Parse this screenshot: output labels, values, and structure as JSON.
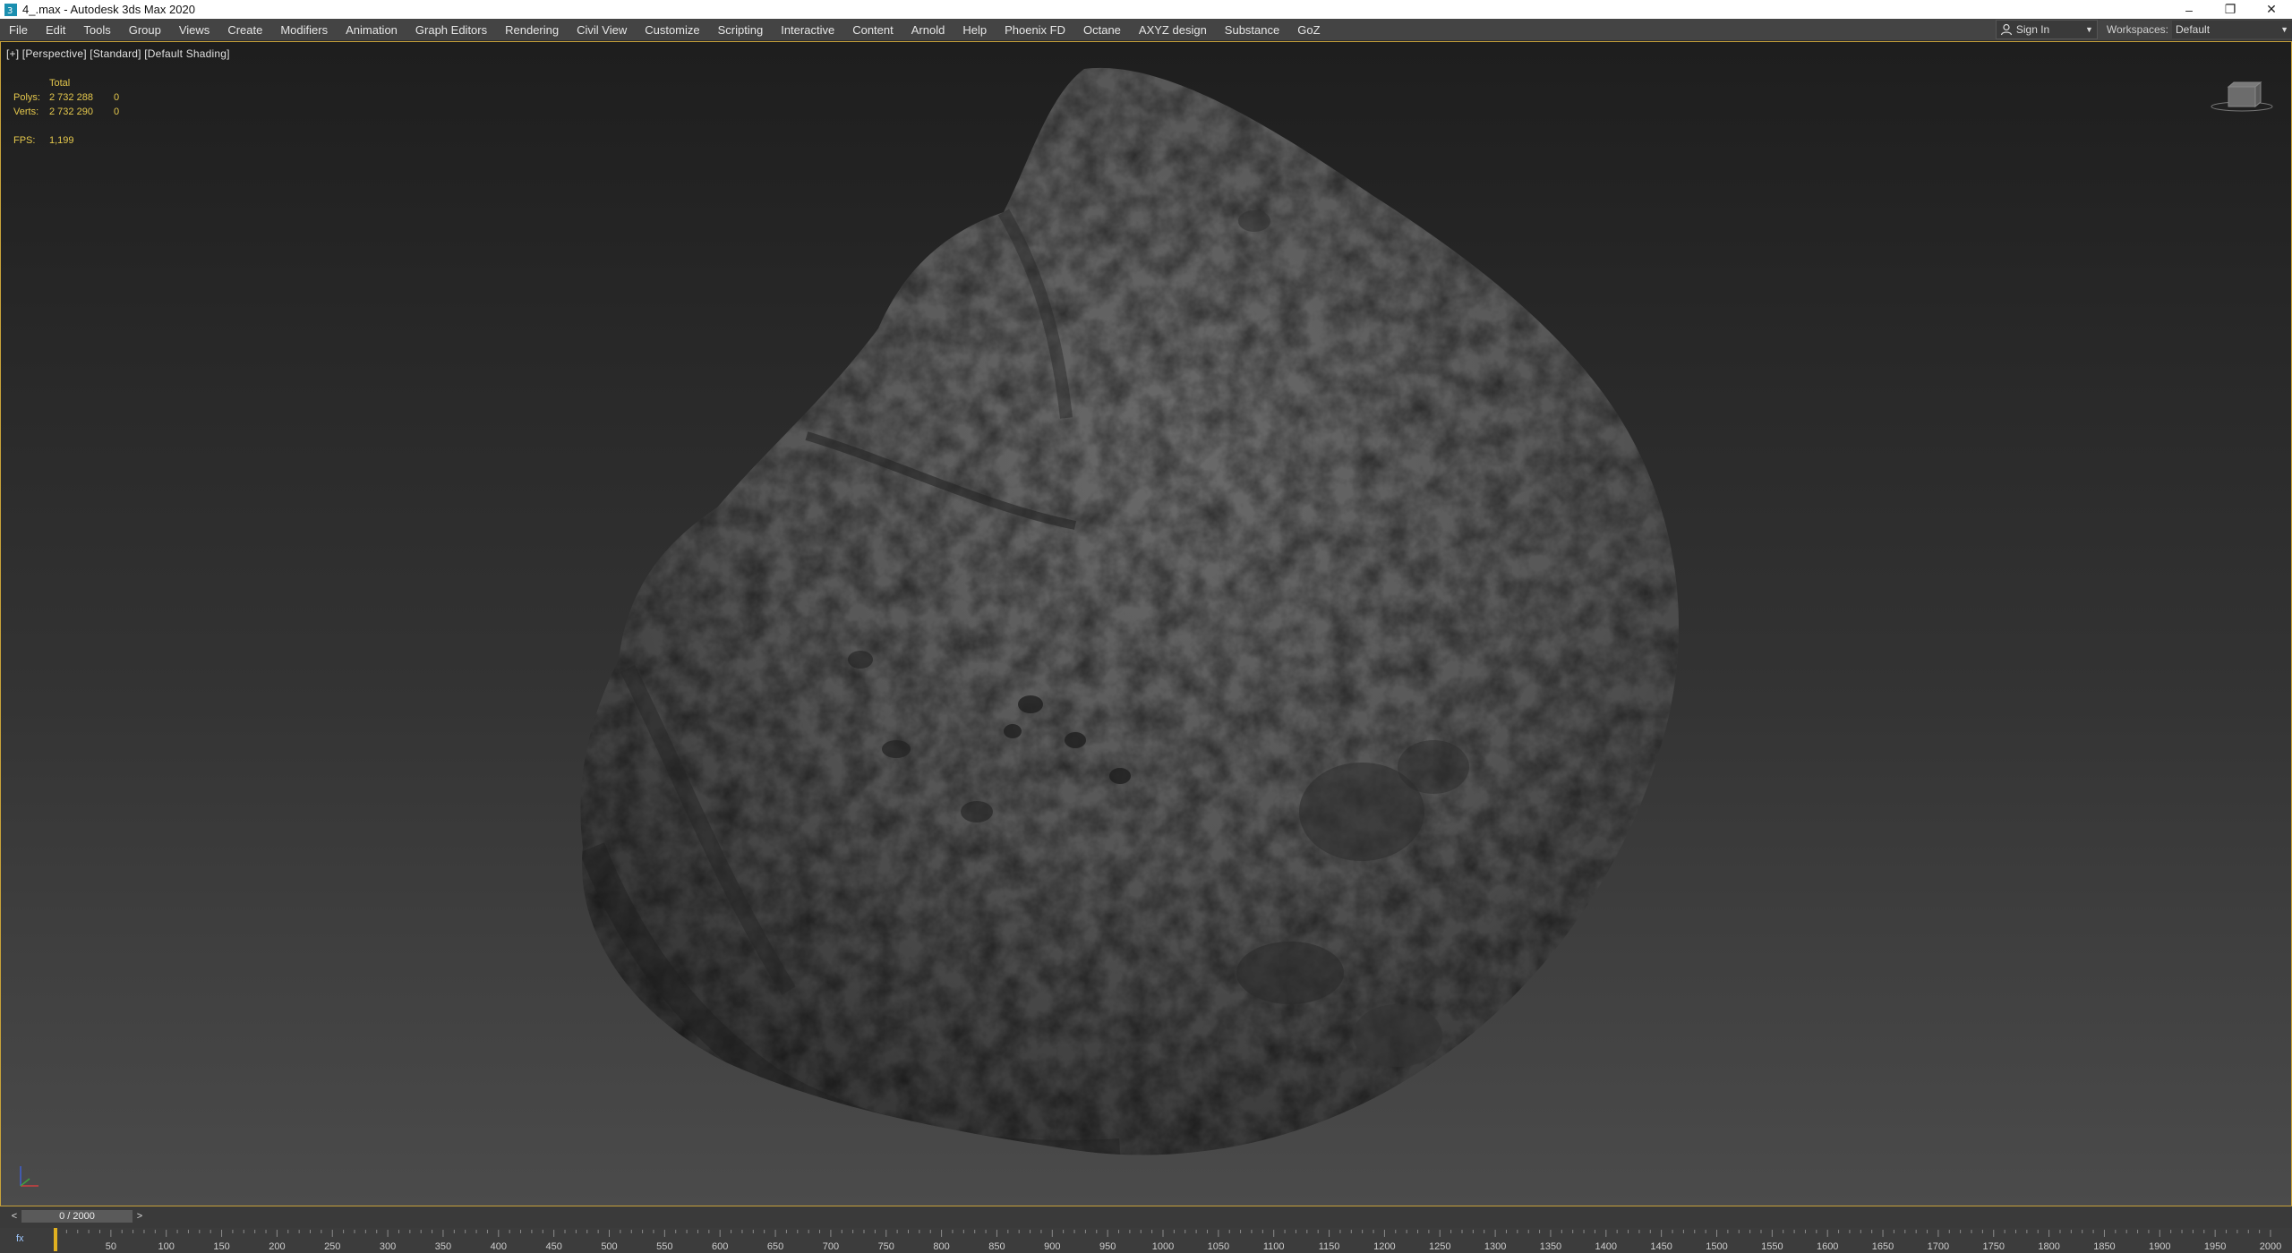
{
  "window": {
    "title": "4_.max - Autodesk 3ds Max 2020",
    "controls": {
      "minimize": "–",
      "restore": "❐",
      "close": "✕"
    }
  },
  "menubar": {
    "items": [
      "File",
      "Edit",
      "Tools",
      "Group",
      "Views",
      "Create",
      "Modifiers",
      "Animation",
      "Graph Editors",
      "Rendering",
      "Civil View",
      "Customize",
      "Scripting",
      "Interactive",
      "Content",
      "Arnold",
      "Help",
      "Phoenix FD",
      "Octane",
      "AXYZ design",
      "Substance",
      "GoZ"
    ],
    "sign_in": "Sign In",
    "workspaces_label": "Workspaces:",
    "workspace_value": "Default"
  },
  "viewport": {
    "label": "[+] [Perspective] [Standard] [Default Shading]",
    "stats": {
      "header": "Total",
      "polys_label": "Polys:",
      "polys_total": "2 732 288",
      "polys_sel": "0",
      "verts_label": "Verts:",
      "verts_total": "2 732 290",
      "verts_sel": "0",
      "fps_label": "FPS:",
      "fps_value": "1,199"
    },
    "border_color": "#c7a23a",
    "stats_color": "#e5c84c"
  },
  "timeline": {
    "prev": "<",
    "next": ">",
    "frame_readout": "0 / 2000",
    "track_icon": "fx",
    "ticks": [
      "50",
      "100",
      "150",
      "200",
      "250",
      "300",
      "350",
      "400",
      "450",
      "500",
      "550",
      "600",
      "650",
      "700",
      "750",
      "800",
      "850",
      "900",
      "950",
      "1000",
      "1050",
      "1100",
      "1150",
      "1200",
      "1250",
      "1300",
      "1350",
      "1400",
      "1450",
      "1500",
      "1550",
      "1600",
      "1650",
      "1700",
      "1750",
      "1800",
      "1850",
      "1900",
      "1950",
      "2000"
    ],
    "tick_max": 2000
  }
}
